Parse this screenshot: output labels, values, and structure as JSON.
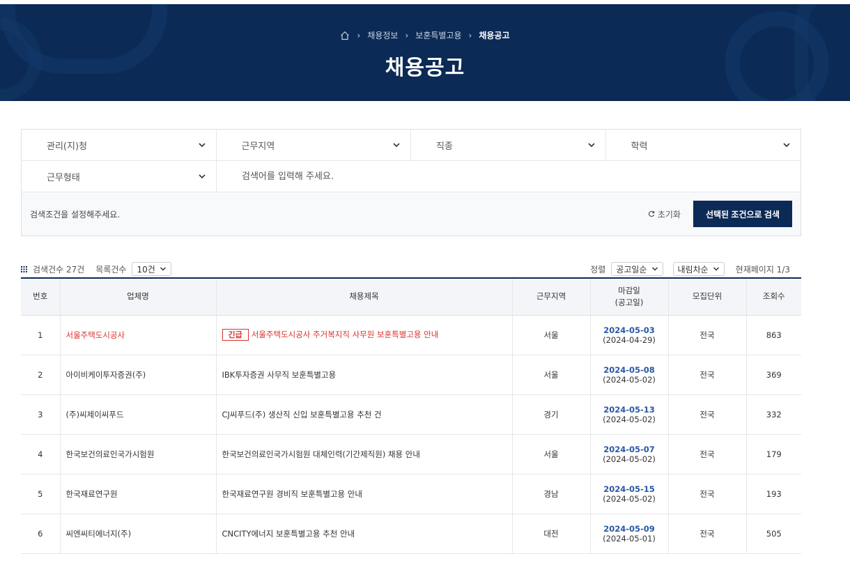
{
  "breadcrumb": [
    "채용정보",
    "보훈특별고용",
    "채용공고"
  ],
  "page_title": "채용공고",
  "filters": {
    "agency": "관리(지)청",
    "region": "근무지역",
    "job": "직종",
    "education": "학력",
    "work_type": "근무형태",
    "search_placeholder": "검색어를 입력해 주세요."
  },
  "status": {
    "message": "검색조건을 설정해주세요.",
    "reset": "초기화",
    "search_button": "선택된 조건으로 검색"
  },
  "list": {
    "count_label": "검색건수 27건",
    "per_page_label": "목록건수",
    "per_page_value": "10건",
    "sort_label": "정렬",
    "sort_value": "공고일순",
    "order_value": "내림차순",
    "page_info": "현재페이지 1/3"
  },
  "table": {
    "headers": {
      "no": "번호",
      "company": "업체명",
      "title": "채용제목",
      "region": "근무지역",
      "due_line1": "마감일",
      "due_line2": "(공고일)",
      "unit": "모집단위",
      "views": "조회수"
    },
    "urgent_badge": "긴급",
    "rows": [
      {
        "no": "1",
        "company": "서울주택도시공사",
        "title": "서울주택도시공사 주거복지직 사무원 보훈특별고용 안내",
        "region": "서울",
        "due": "2024-05-03",
        "posted": "(2024-04-29)",
        "unit": "전국",
        "views": "863"
      },
      {
        "no": "2",
        "company": "아이비케이투자증권(주)",
        "title": "IBK투자증권 사무직 보훈특별고용",
        "region": "서울",
        "due": "2024-05-08",
        "posted": "(2024-05-02)",
        "unit": "전국",
        "views": "369"
      },
      {
        "no": "3",
        "company": "(주)씨제이씨푸드",
        "title": "CJ씨푸드(주) 생산직 신입 보훈특별고용 추천 건",
        "region": "경기",
        "due": "2024-05-13",
        "posted": "(2024-05-02)",
        "unit": "전국",
        "views": "332"
      },
      {
        "no": "4",
        "company": "한국보건의료인국가시험원",
        "title": "한국보건의료인국가시험원 대체인력(기간제직원) 채용 안내",
        "region": "서울",
        "due": "2024-05-07",
        "posted": "(2024-05-02)",
        "unit": "전국",
        "views": "179"
      },
      {
        "no": "5",
        "company": "한국재료연구원",
        "title": "한국재료연구원 경비직 보훈특별고용 안내",
        "region": "경남",
        "due": "2024-05-15",
        "posted": "(2024-05-02)",
        "unit": "전국",
        "views": "193"
      },
      {
        "no": "6",
        "company": "씨엔씨티에너지(주)",
        "title": "CNCITY에너지 보훈특별고용 추천 안내",
        "region": "대전",
        "due": "2024-05-09",
        "posted": "(2024-05-01)",
        "unit": "전국",
        "views": "505"
      }
    ]
  },
  "colors": {
    "navy": "#0b2a55",
    "urgent": "#d9322b",
    "due_blue": "#2a58a6"
  }
}
